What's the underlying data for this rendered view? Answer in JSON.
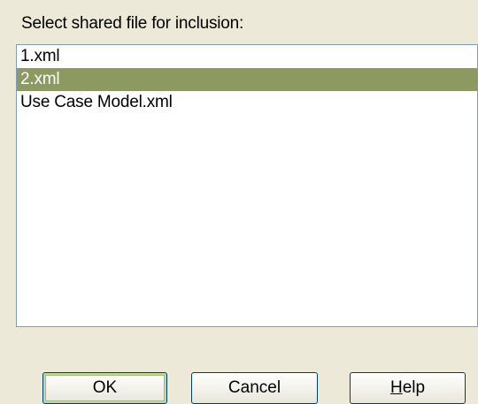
{
  "dialog": {
    "prompt": "Select shared file for inclusion:"
  },
  "file_list": {
    "items": [
      {
        "label": "1.xml",
        "selected": false
      },
      {
        "label": "2.xml",
        "selected": true
      },
      {
        "label": "Use Case Model.xml",
        "selected": false
      }
    ],
    "selection_color": "#8c9a62"
  },
  "buttons": {
    "ok_label": "OK",
    "cancel_label": "Cancel",
    "help_mnemonic": "H",
    "help_rest": "elp"
  }
}
